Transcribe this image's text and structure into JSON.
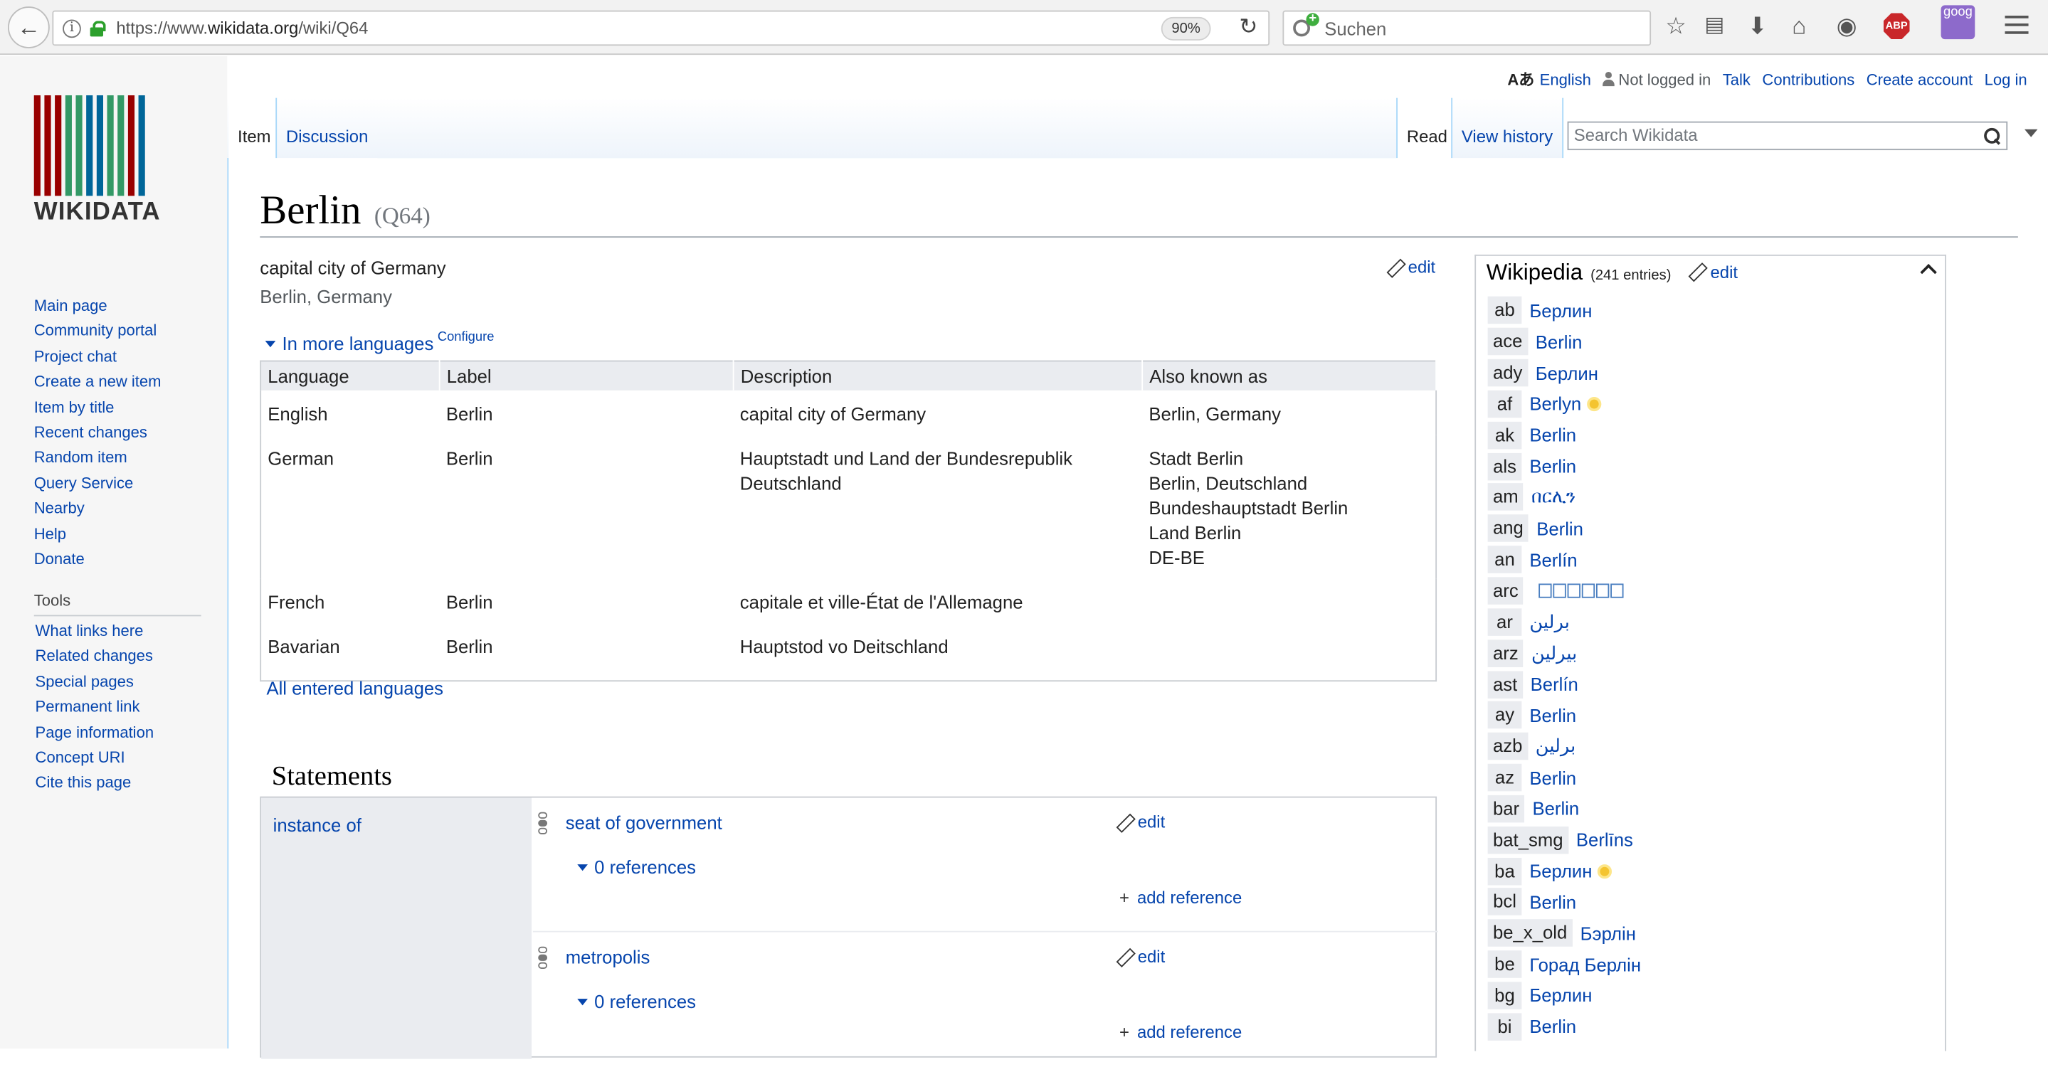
{
  "browser": {
    "url_prefix": "https://www.",
    "url_domain": "wikidata.org",
    "url_path": "/wiki/Q64",
    "zoom": "90%",
    "search_placeholder": "Suchen",
    "abp": "ABP",
    "goog": "goog"
  },
  "logo": {
    "text": "WIKIDATA",
    "bar_colors": [
      "#990000",
      "#990000",
      "#990000",
      "#339966",
      "#339966",
      "#006699",
      "#006699",
      "#339966",
      "#339966",
      "#990000",
      "#006699"
    ]
  },
  "personal": {
    "lang_icon": "Aあ",
    "language": "English",
    "not_logged_in": "Not logged in",
    "talk": "Talk",
    "contributions": "Contributions",
    "create_account": "Create account",
    "log_in": "Log in"
  },
  "tabs": {
    "item": "Item",
    "discussion": "Discussion",
    "read": "Read",
    "view_history": "View history"
  },
  "search": {
    "placeholder": "Search Wikidata"
  },
  "nav": [
    "Main page",
    "Community portal",
    "Project chat",
    "Create a new item",
    "Item by title",
    "Recent changes",
    "Random item",
    "Query Service",
    "Nearby",
    "Help",
    "Donate"
  ],
  "tools": {
    "title": "Tools",
    "items": [
      "What links here",
      "Related changes",
      "Special pages",
      "Permanent link",
      "Page information",
      "Concept URI",
      "Cite this page"
    ]
  },
  "item": {
    "label": "Berlin",
    "qid": "(Q64)",
    "description": "capital city of Germany",
    "aliases": "Berlin, Germany",
    "edit": "edit",
    "more_languages": "In more languages",
    "configure": "Configure",
    "all_languages": "All entered languages"
  },
  "lang_table": {
    "headers": [
      "Language",
      "Label",
      "Description",
      "Also known as"
    ],
    "rows": [
      {
        "language": "English",
        "label": "Berlin",
        "description": "capital city of Germany",
        "aliases": [
          "Berlin, Germany"
        ]
      },
      {
        "language": "German",
        "label": "Berlin",
        "description": "Hauptstadt und Land der Bundesrepublik Deutschland",
        "aliases": [
          "Stadt Berlin",
          "Berlin, Deutschland",
          "Bundeshauptstadt Berlin",
          "Land Berlin",
          "DE-BE"
        ]
      },
      {
        "language": "French",
        "label": "Berlin",
        "description": "capitale et ville-État de l'Allemagne",
        "aliases": []
      },
      {
        "language": "Bavarian",
        "label": "Berlin",
        "description": "Hauptstod vo Deitschland",
        "aliases": []
      }
    ]
  },
  "statements": {
    "title": "Statements",
    "property": "instance of",
    "claims": [
      {
        "value": "seat of government",
        "references": "0 references",
        "edit": "edit",
        "add_reference": "add reference"
      },
      {
        "value": "metropolis",
        "references": "0 references",
        "edit": "edit",
        "add_reference": "add reference"
      }
    ]
  },
  "wikipedia": {
    "title": "Wikipedia",
    "count": "(241 entries)",
    "edit": "edit",
    "links": [
      {
        "code": "ab",
        "title": "Берлин"
      },
      {
        "code": "ace",
        "title": "Berlin"
      },
      {
        "code": "ady",
        "title": "Берлин"
      },
      {
        "code": "af",
        "title": "Berlyn",
        "badge": true
      },
      {
        "code": "ak",
        "title": "Berlin"
      },
      {
        "code": "als",
        "title": "Berlin"
      },
      {
        "code": "am",
        "title": "በርሊን"
      },
      {
        "code": "ang",
        "title": "Berlin"
      },
      {
        "code": "an",
        "title": "Berlín"
      },
      {
        "code": "arc",
        "title": "",
        "boxes": true
      },
      {
        "code": "ar",
        "title": "برلين"
      },
      {
        "code": "arz",
        "title": "بيرلين"
      },
      {
        "code": "ast",
        "title": "Berlín"
      },
      {
        "code": "ay",
        "title": "Berlin"
      },
      {
        "code": "azb",
        "title": "برلین"
      },
      {
        "code": "az",
        "title": "Berlin"
      },
      {
        "code": "bar",
        "title": "Berlin"
      },
      {
        "code": "bat_smg",
        "title": "Berlīns"
      },
      {
        "code": "ba",
        "title": "Берлин",
        "badge": true
      },
      {
        "code": "bcl",
        "title": "Berlin"
      },
      {
        "code": "be_x_old",
        "title": "Бэрлін"
      },
      {
        "code": "be",
        "title": "Горад Берлін"
      },
      {
        "code": "bg",
        "title": "Берлин"
      },
      {
        "code": "bi",
        "title": "Berlin"
      }
    ]
  }
}
